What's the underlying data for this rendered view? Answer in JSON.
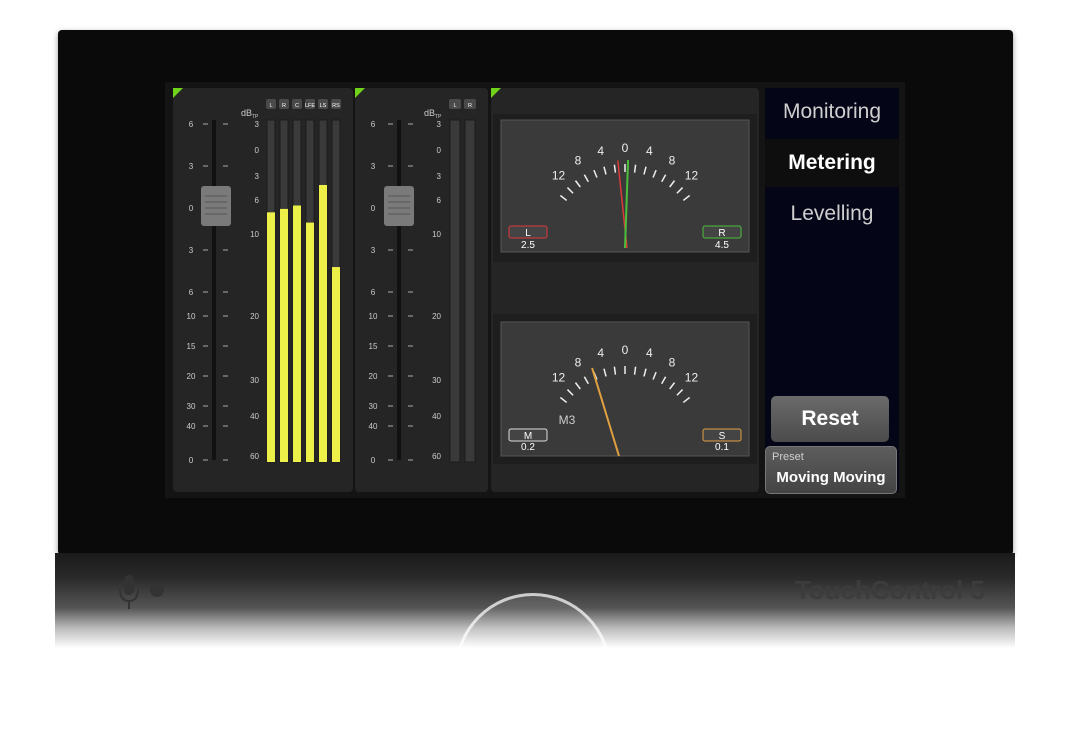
{
  "brand": "TouchControl 5",
  "nav": [
    {
      "label": "Monitoring",
      "active": false
    },
    {
      "label": "Metering",
      "active": true
    },
    {
      "label": "Levelling",
      "active": false
    }
  ],
  "reset_label": "Reset",
  "preset": {
    "label": "Preset",
    "value": "Moving Moving"
  },
  "fader_scale": [
    "6",
    "3",
    "0",
    "3",
    "6",
    "10",
    "15",
    "20",
    "30",
    "40",
    "0"
  ],
  "meter_unit": "dB",
  "meter_unit_sub": "TP",
  "meter_scale": [
    "3",
    "0",
    "3",
    "6",
    "10",
    "20",
    "30",
    "40",
    "60"
  ],
  "surround": {
    "channels": [
      "L",
      "R",
      "C",
      "LFE",
      "LS",
      "RS"
    ],
    "levels": [
      0.73,
      0.74,
      0.75,
      0.7,
      0.81,
      0.57
    ]
  },
  "stereo": {
    "channels": [
      "L",
      "R"
    ],
    "levels": [
      0,
      0
    ]
  },
  "vu_scale": [
    "12",
    "8",
    "4",
    "0",
    "4",
    "8",
    "12"
  ],
  "vu_top": {
    "left_label": "L",
    "left_value": "2.5",
    "right_label": "R",
    "right_value": "4.5",
    "colors": {
      "left": "#d93b3b",
      "right": "#4bbf3a"
    }
  },
  "vu_bottom": {
    "center_label": "M3",
    "left_label": "M",
    "left_value": "0.2",
    "right_label": "S",
    "right_value": "0.1",
    "colors": {
      "left": "#dddddd",
      "right": "#e0a040"
    }
  },
  "colors": {
    "meter": "#eef04a",
    "accent": "#6fd21b",
    "nav_bg": "#050518"
  }
}
